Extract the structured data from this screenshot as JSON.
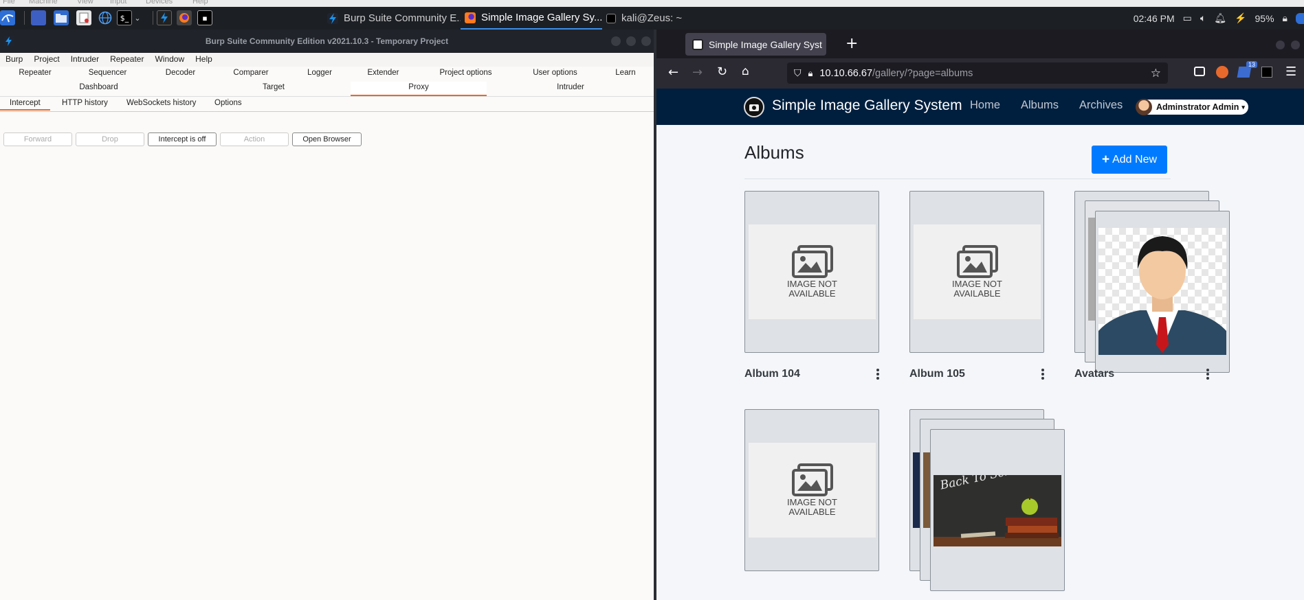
{
  "vm_menu": [
    "File",
    "Machine",
    "View",
    "Input",
    "Devices",
    "Help"
  ],
  "taskbar": {
    "tasks": [
      {
        "label": "Burp Suite Community E..."
      },
      {
        "label": "Simple Image Gallery Sy..."
      },
      {
        "label": "kali@Zeus: ~"
      }
    ],
    "clock": "02:46 PM",
    "battery": "95%"
  },
  "burp": {
    "title": "Burp Suite Community Edition v2021.10.3 - Temporary Project",
    "menu": [
      "Burp",
      "Project",
      "Intruder",
      "Repeater",
      "Window",
      "Help"
    ],
    "tabs_row1": [
      "Repeater",
      "Sequencer",
      "Decoder",
      "Comparer",
      "Logger",
      "Extender",
      "Project options",
      "User options",
      "Learn"
    ],
    "tabs_row2": [
      "Dashboard",
      "Target",
      "Proxy",
      "Intruder"
    ],
    "subtabs": [
      "Intercept",
      "HTTP history",
      "WebSockets history",
      "Options"
    ],
    "buttons": {
      "forward": "Forward",
      "drop": "Drop",
      "intercept": "Intercept is off",
      "action": "Action",
      "open_browser": "Open Browser"
    }
  },
  "firefox": {
    "tab_title": "Simple Image Gallery Syst",
    "url_host": "10.10.66.67",
    "url_path": "/gallery/?page=albums",
    "badge": "13"
  },
  "site": {
    "brand": "Simple Image Gallery System",
    "nav": [
      "Home",
      "Albums",
      "Archives"
    ],
    "user": "Adminstrator Admin",
    "heading": "Albums",
    "add_button": "Add New",
    "no_image_line1": "IMAGE NOT",
    "no_image_line2": "AVAILABLE",
    "chalk_text": "Back To School !",
    "albums": [
      {
        "name": "Album 104"
      },
      {
        "name": "Album 105"
      },
      {
        "name": "Avatars"
      }
    ]
  },
  "colors": {
    "navbar": "#001f3f",
    "primary": "#007bff",
    "burp_accent": "#e8692c"
  }
}
